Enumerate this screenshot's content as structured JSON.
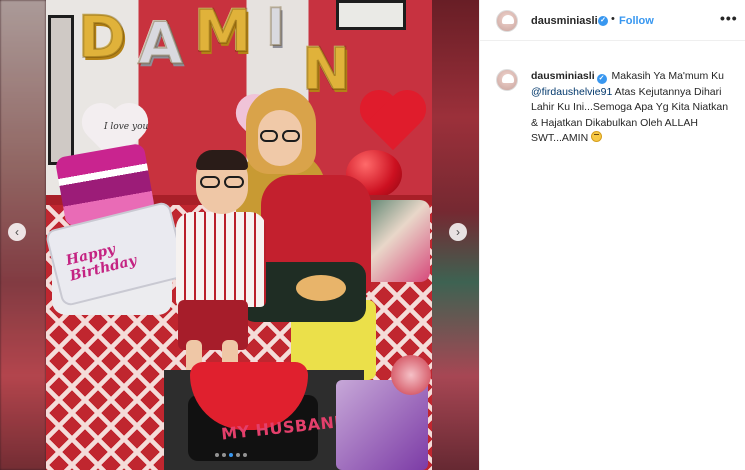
{
  "post": {
    "username": "dausminiasli",
    "verified": true,
    "follow_label": "Follow",
    "separator": "•",
    "more_icon": "•••"
  },
  "caption": {
    "username": "dausminiasli",
    "text_before_mention": "Makasih Ya Ma'mum Ku",
    "mention": "@firdaushelvie91",
    "text_after_mention": "Atas Kejutannya Dihari Lahir Ku Ini...Semoga Apa Yg Kita Niatkan & Hajatkan Dikabulkan Oleh ALLAH SWT...AMIN",
    "emoji": "smiling-face-with-halo"
  },
  "media": {
    "balloon_letters": [
      "D",
      "A",
      "M",
      "I",
      "N"
    ],
    "cake_text": "MY HUSBAND",
    "birthday_balloon_text": "Happy Birthday",
    "heart_balloon_text": "I love you",
    "nav_prev_icon": "‹",
    "nav_next_icon": "›",
    "carousel_dots": 5,
    "active_dot": 2
  },
  "colors": {
    "accent": "#3897f0",
    "mention": "#00376b",
    "text": "#262626"
  }
}
